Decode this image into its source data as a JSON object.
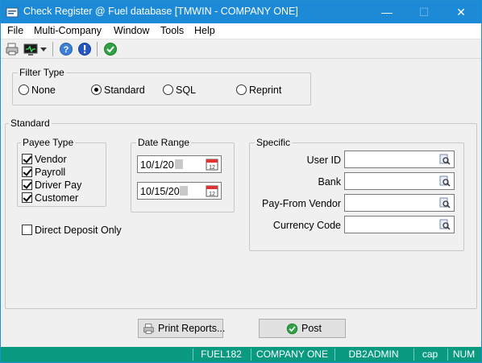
{
  "window": {
    "title": "Check Register @ Fuel database [TMWIN - COMPANY ONE]",
    "controls": {
      "minimize": "—",
      "maximize": "☐",
      "close": "✕"
    }
  },
  "menu": [
    "File",
    "Multi-Company",
    "Window",
    "Tools",
    "Help"
  ],
  "toolbar": {
    "icons": [
      "printer-icon",
      "monitor-icon",
      "dropdown-arrow-icon",
      "help-icon",
      "info-icon",
      "checkmark-icon"
    ]
  },
  "filter_type": {
    "label": "Filter Type",
    "options": [
      "None",
      "Standard",
      "SQL",
      "Reprint"
    ],
    "selected": "Standard"
  },
  "standard": {
    "label": "Standard",
    "payee_type": {
      "label": "Payee Type",
      "options": [
        {
          "label": "Vendor",
          "checked": true
        },
        {
          "label": "Payroll",
          "checked": true
        },
        {
          "label": "Driver Pay",
          "checked": true
        },
        {
          "label": "Customer",
          "checked": true
        }
      ]
    },
    "direct_deposit": {
      "label": "Direct Deposit Only",
      "checked": false
    },
    "date_range": {
      "label": "Date Range",
      "from": "10/1/20",
      "to": "10/15/20"
    },
    "specific": {
      "label": "Specific",
      "fields": [
        {
          "label": "User ID",
          "value": ""
        },
        {
          "label": "Bank",
          "value": ""
        },
        {
          "label": "Pay-From Vendor",
          "value": ""
        },
        {
          "label": "Currency Code",
          "value": ""
        }
      ]
    }
  },
  "buttons": {
    "print_reports": "Print Reports...",
    "post": "Post"
  },
  "status_bar": [
    "FUEL182",
    "COMPANY ONE",
    "DB2ADMIN",
    "cap",
    "NUM"
  ],
  "colors": {
    "title_bar": "#1c8ad6",
    "status_bar": "#0a9a82",
    "dialog_bg": "#f0f0f0"
  }
}
